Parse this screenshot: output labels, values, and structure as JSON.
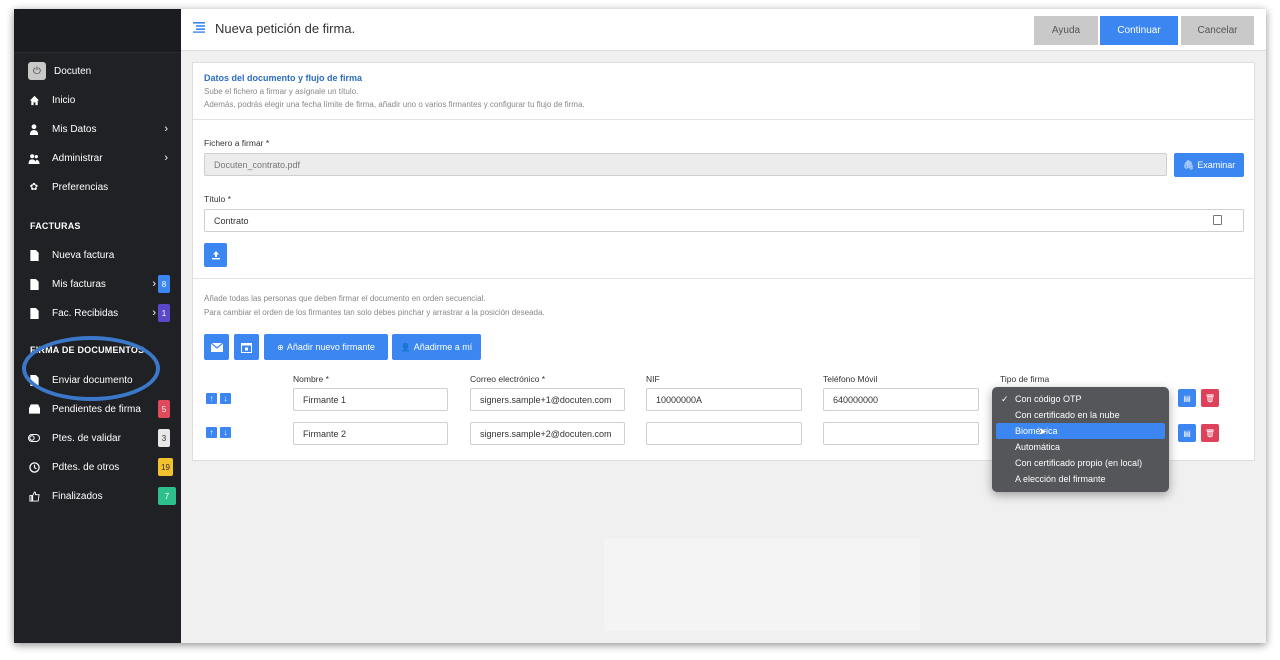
{
  "sidebar": {
    "brand": "Docuten",
    "items": [
      {
        "label": "Inicio",
        "icon": "home-icon"
      },
      {
        "label": "Mis Datos",
        "icon": "user-icon"
      },
      {
        "label": "Administrar",
        "icon": "users-icon"
      },
      {
        "label": "Preferencias",
        "icon": "gear-icon"
      }
    ],
    "facturas_head": "FACTURAS",
    "facturas": [
      {
        "label": "Nueva factura"
      },
      {
        "label": "Mis facturas",
        "badge": "8"
      },
      {
        "label": "Fac. Recibidas",
        "badge": "1"
      }
    ],
    "firma_head": "FIRMA DE DOCUMENTOS",
    "firma": [
      {
        "label": "Enviar documento"
      },
      {
        "label": "Pendientes de firma",
        "badge": "5"
      },
      {
        "label": "Ptes. de validar",
        "badge": "3"
      },
      {
        "label": "Pdtes. de otros",
        "badge": "19"
      },
      {
        "label": "Finalizados",
        "badge": "7"
      }
    ],
    "colors": {
      "badge_blue": "#3b86f0",
      "badge_purple": "#5b48c9",
      "badge_red": "#e04a5a",
      "badge_white": "#e8e8e8",
      "badge_yellow": "#f2c12e",
      "badge_green": "#2dbf8c"
    }
  },
  "header": {
    "title": "Nueva petición de firma.",
    "help": "Ayuda",
    "continue": "Continuar",
    "cancel": "Cancelar"
  },
  "document": {
    "section_title": "Datos del documento y flujo de firma",
    "sub1": "Sube el fichero a firmar y asígnale un título.",
    "sub2": "Además, podrás elegir una fecha límite de firma, añadir uno o varios firmantes y configurar tu flujo de firma.",
    "file_label": "Fichero a firmar *",
    "file_value": "Docuten_contrato.pdf",
    "browse": "Examinar",
    "title_label": "Título *",
    "title_value": "Contrato"
  },
  "signers": {
    "info1": "Añade todas las personas que deben firmar el documento en orden secuencial.",
    "info2": "Para cambiar el orden de los firmantes tan solo debes pinchar y arrastrar a la posición deseada.",
    "add_signer": "Añadir nuevo firmante",
    "add_me": "Añadirme a mí",
    "col_name": "Nombre *",
    "col_email": "Correo electrónico *",
    "col_nif": "NIF",
    "col_phone": "Teléfono Móvil",
    "col_type": "Tipo de firma",
    "rows": [
      {
        "name": "Firmante 1",
        "email": "signers.sample+1@docuten.com",
        "nif": "10000000A",
        "phone": "640000000"
      },
      {
        "name": "Firmante 2",
        "email": "signers.sample+2@docuten.com",
        "nif": "",
        "phone": ""
      }
    ]
  },
  "signature_type_dropdown": {
    "options": [
      {
        "label": "Con código OTP",
        "checked": true
      },
      {
        "label": "Con certificado en la nube"
      },
      {
        "label": "Biométrica",
        "highlighted": true
      },
      {
        "label": "Automática"
      },
      {
        "label": "Con certificado propio (en local)"
      },
      {
        "label": "A elección del firmante"
      }
    ]
  }
}
